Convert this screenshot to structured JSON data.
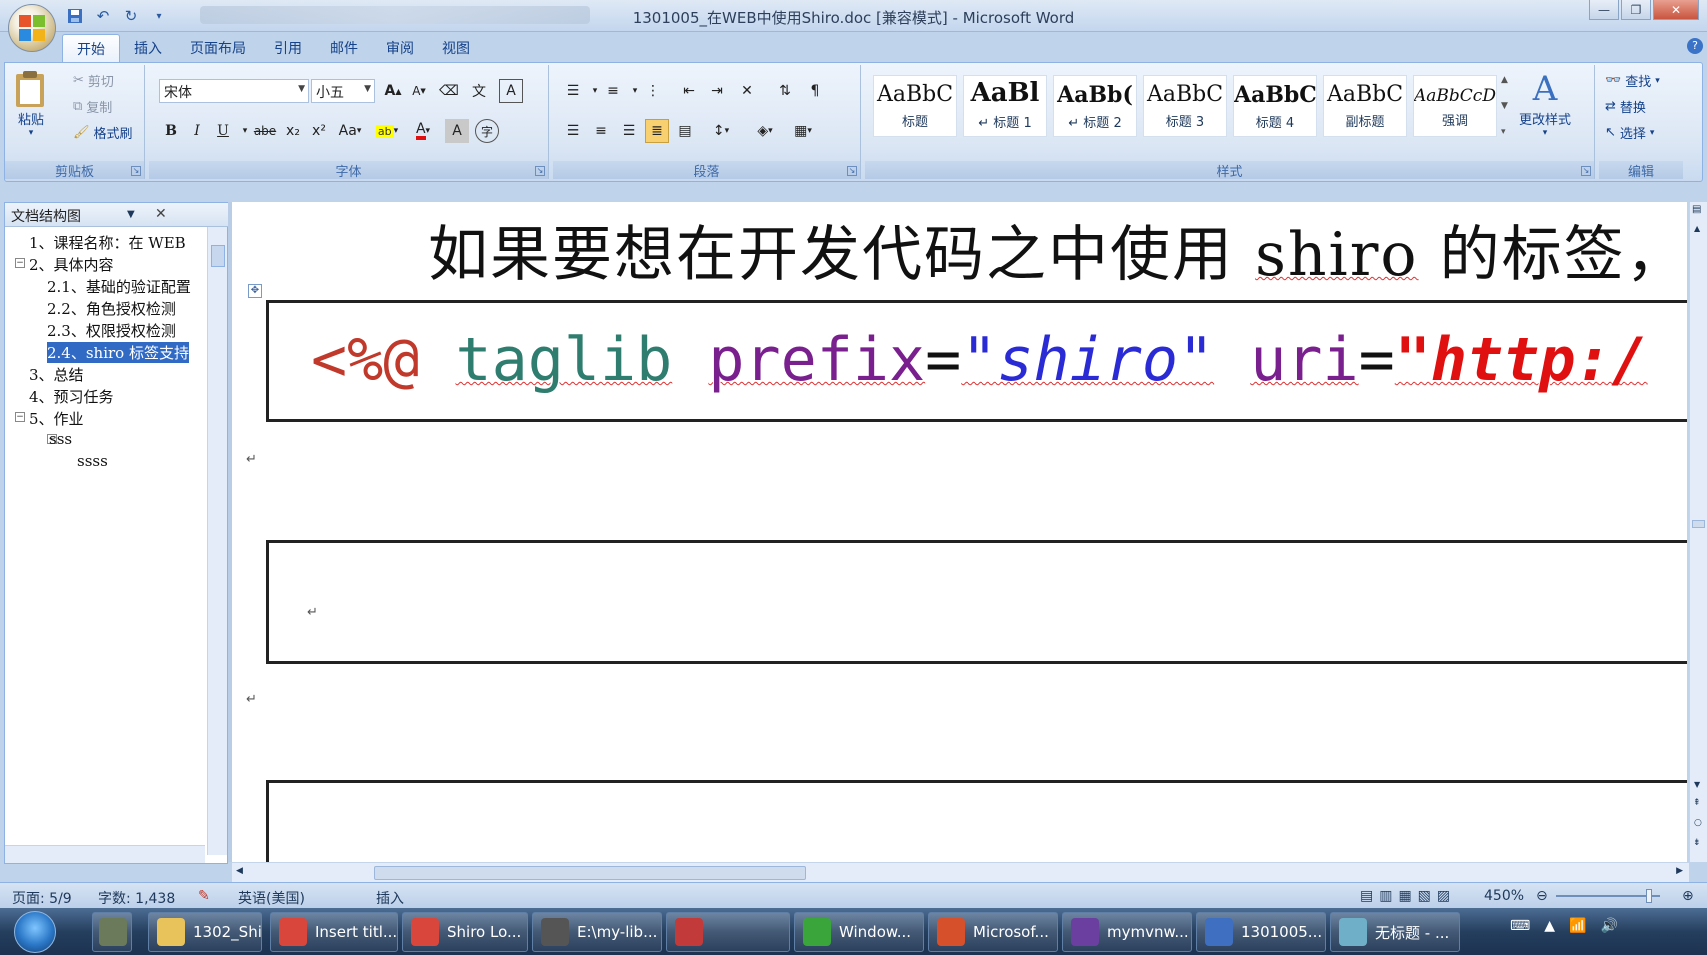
{
  "window": {
    "title": "1301005_在WEB中使用Shiro.doc [兼容模式] - Microsoft Word"
  },
  "qat": {
    "save_icon": "save-icon",
    "undo_icon": "undo-icon",
    "redo_icon": "redo-icon"
  },
  "tabs": [
    "开始",
    "插入",
    "页面布局",
    "引用",
    "邮件",
    "审阅",
    "视图"
  ],
  "ribbon": {
    "clipboard": {
      "label": "剪贴板",
      "paste": "粘贴",
      "cut": "剪切",
      "copy": "复制",
      "format_painter": "格式刷"
    },
    "font": {
      "label": "字体",
      "font_name": "宋体",
      "font_size": "小五",
      "bold": "B",
      "italic": "I",
      "underline": "U",
      "strike": "abe",
      "subscript": "x₂",
      "superscript": "x²",
      "change_case": "Aa",
      "grow": "A",
      "shrink": "A",
      "phonetic": "文",
      "char_border": "A",
      "font_color": "A",
      "char_shading": "A",
      "enclose": "字"
    },
    "paragraph": {
      "label": "段落"
    },
    "styles": {
      "label": "样式",
      "items": [
        {
          "sample": "AaBbC",
          "name": "标题"
        },
        {
          "sample": "AaBl",
          "name": "↵ 标题 1"
        },
        {
          "sample": "AaBb(",
          "name": "↵ 标题 2"
        },
        {
          "sample": "AaBbC",
          "name": "标题 3"
        },
        {
          "sample": "AaBbC",
          "name": "标题 4"
        },
        {
          "sample": "AaBbC",
          "name": "副标题"
        },
        {
          "sample": "AaBbCcDc",
          "name": "强调"
        }
      ],
      "change_styles": "更改样式"
    },
    "editing": {
      "label": "编辑",
      "find": "查找",
      "replace": "替换",
      "select": "选择"
    }
  },
  "navpane": {
    "title": "文档结构图",
    "items": [
      {
        "text": "1、课程名称：在 WEB",
        "level": 0,
        "expander": ""
      },
      {
        "text": "2、具体内容",
        "level": 0,
        "expander": "⊟"
      },
      {
        "text": "2.1、基础的验证配置",
        "level": 1,
        "expander": ""
      },
      {
        "text": "2.2、角色授权检测",
        "level": 1,
        "expander": ""
      },
      {
        "text": "2.3、权限授权检测",
        "level": 1,
        "expander": ""
      },
      {
        "text": "2.4、shiro 标签支持",
        "level": 1,
        "expander": "",
        "selected": true
      },
      {
        "text": "3、总结",
        "level": 0,
        "expander": ""
      },
      {
        "text": "4、预习任务",
        "level": 0,
        "expander": ""
      },
      {
        "text": "5、作业",
        "level": 0,
        "expander": "⊟"
      },
      {
        "text": "sss",
        "level": 2,
        "expander": "⊟"
      },
      {
        "text": "ssss",
        "level": 3,
        "expander": ""
      }
    ]
  },
  "document": {
    "heading": "如果要想在开发代码之中使用 shiro 的标签，",
    "heading_parts": [
      "如果要想在开发代码之中使用 ",
      "shiro",
      " 的标签，"
    ],
    "code": {
      "open": "<%@",
      "keyword": "taglib",
      "attr1": "prefix",
      "eq": "=",
      "val1": "\"shiro\"",
      "attr2": "uri",
      "val2": "\"http:/"
    },
    "para_mark": "↵"
  },
  "statusbar": {
    "page": "页面: 5/9",
    "words": "字数: 1,438",
    "language": "英语(美国)",
    "mode": "插入",
    "zoom": "450%"
  },
  "taskbar": {
    "items": [
      {
        "label": "1302_Shi...",
        "color": "#e8c25a"
      },
      {
        "label": "Insert titl...",
        "color": "#d9463b"
      },
      {
        "label": "Shiro Lo...",
        "color": "#d9463b"
      },
      {
        "label": "E:\\my-lib...",
        "color": "#555555"
      },
      {
        "label": "",
        "color": "#c23a3a"
      },
      {
        "label": "Window...",
        "color": "#3aa53a"
      },
      {
        "label": "Microsof...",
        "color": "#d6502b"
      },
      {
        "label": "mymvnw...",
        "color": "#6a3fa0"
      },
      {
        "label": "1301005...",
        "color": "#3f6fc0"
      },
      {
        "label": "无标题 - ...",
        "color": "#6fb0c8"
      }
    ]
  }
}
